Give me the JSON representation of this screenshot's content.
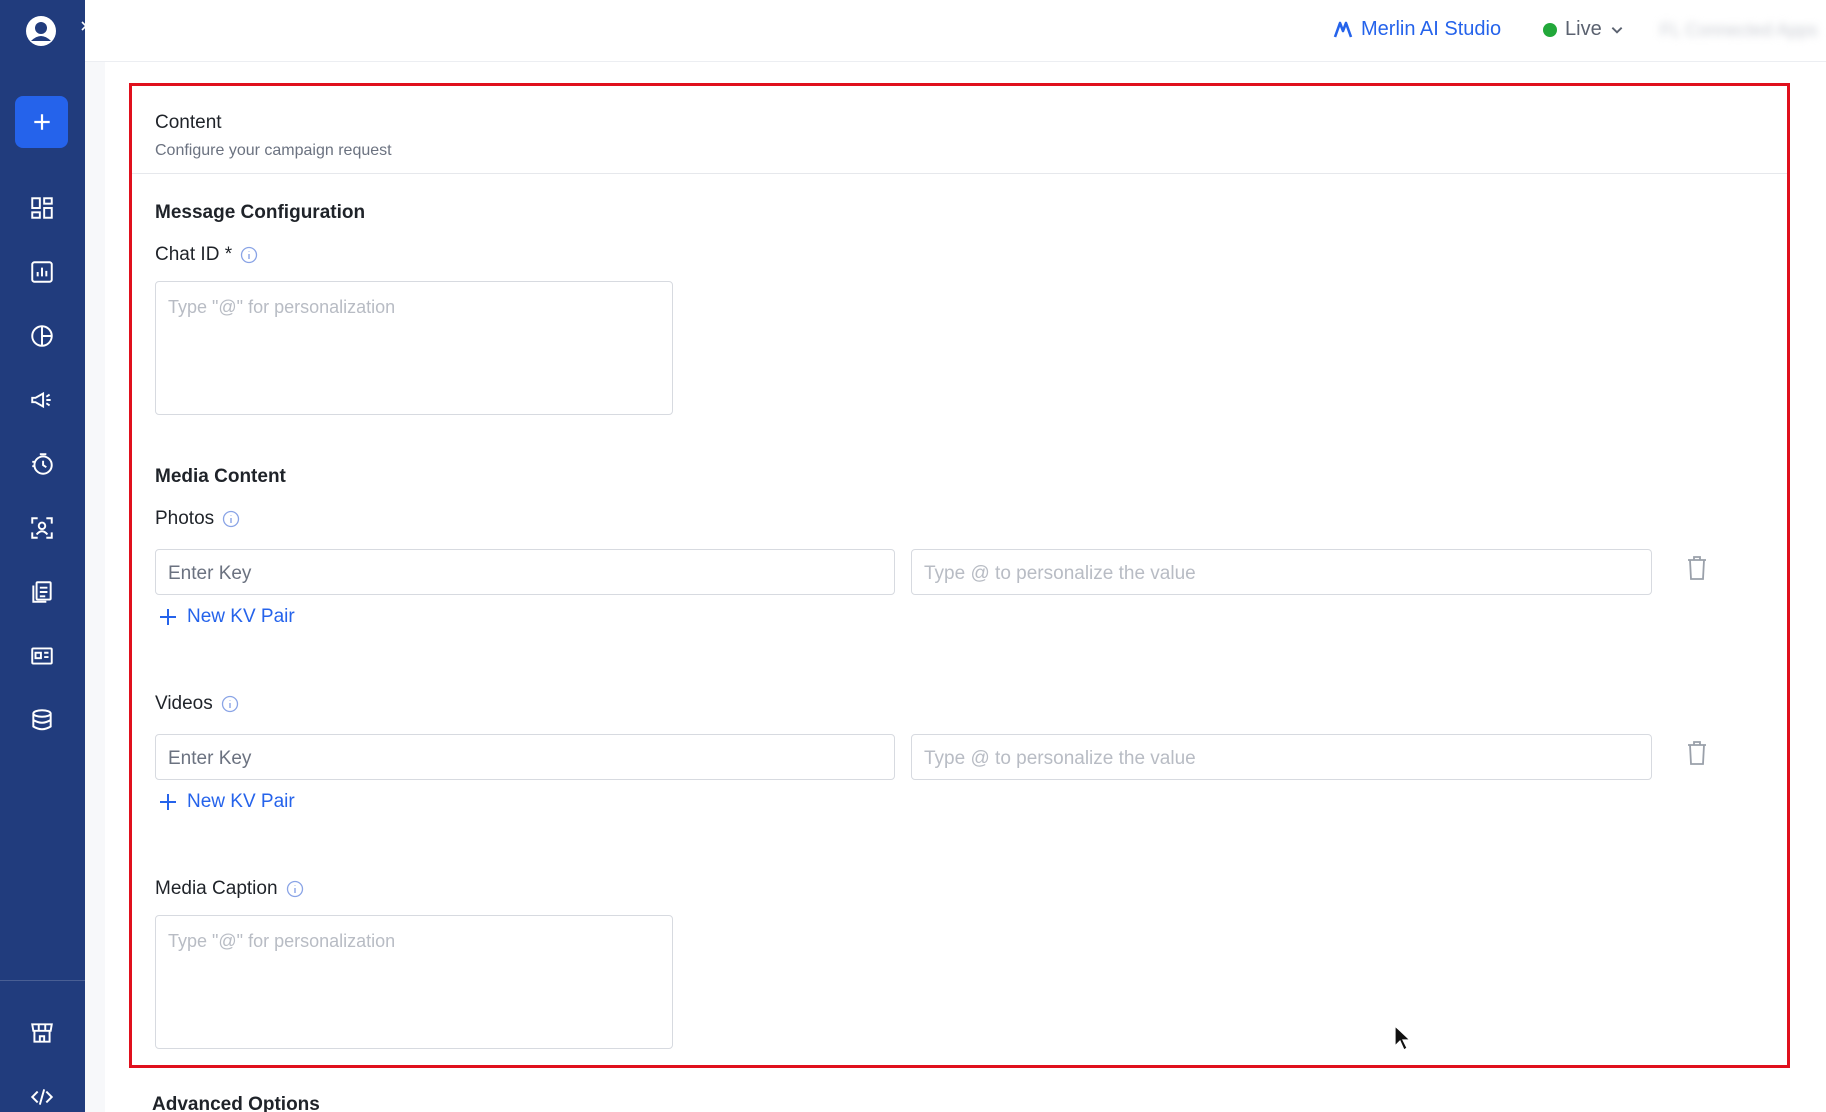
{
  "topbar": {
    "studio_label": "Merlin AI Studio",
    "env_label": "Live",
    "account_label": "FL Connected Apps"
  },
  "colors": {
    "sidebar": "#213c7d",
    "accent": "#2563eb",
    "live": "#22a83a",
    "highlight_border": "#e0101d"
  },
  "sidebar": {
    "items": [
      {
        "icon": "dashboard-icon"
      },
      {
        "icon": "analytics-icon"
      },
      {
        "icon": "segments-icon"
      },
      {
        "icon": "campaigns-icon"
      },
      {
        "icon": "journeys-icon"
      },
      {
        "icon": "contacts-icon"
      },
      {
        "icon": "templates-icon"
      },
      {
        "icon": "content-icon"
      },
      {
        "icon": "database-icon"
      }
    ],
    "bottom_items": [
      {
        "icon": "marketplace-icon"
      },
      {
        "icon": "developer-icon"
      }
    ]
  },
  "content": {
    "title": "Content",
    "subtitle": "Configure your campaign request",
    "message_config": {
      "title": "Message Configuration",
      "chat_id_label": "Chat ID *",
      "chat_id_placeholder": "Type \"@\" for personalization"
    },
    "media": {
      "title": "Media Content",
      "photos": {
        "label": "Photos",
        "key_placeholder": "Enter Key",
        "value_placeholder": "Type @ to personalize the value",
        "add_label": "New KV Pair"
      },
      "videos": {
        "label": "Videos",
        "key_placeholder": "Enter Key",
        "value_placeholder": "Type @ to personalize the value",
        "add_label": "New KV Pair"
      },
      "caption": {
        "label": "Media Caption",
        "placeholder": "Type \"@\" for personalization"
      }
    }
  },
  "advanced": {
    "title": "Advanced Options"
  }
}
